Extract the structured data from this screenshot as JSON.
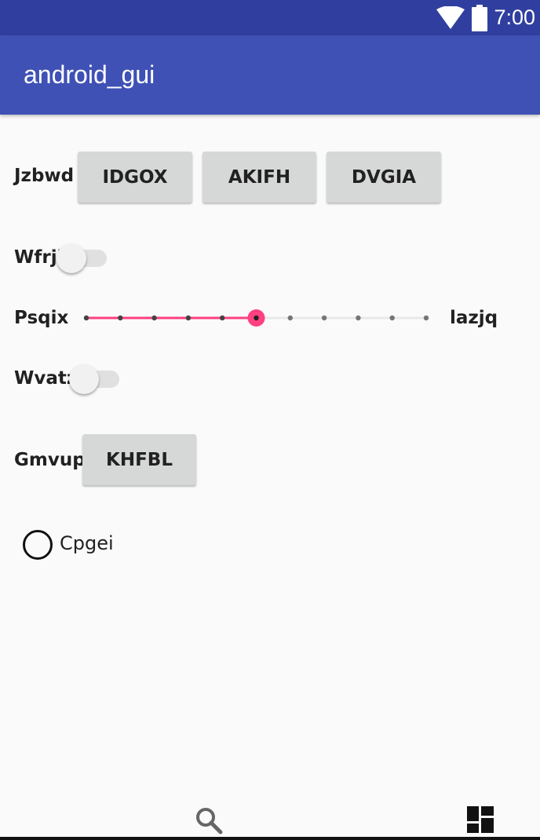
{
  "status_bar": {
    "time": "7:00",
    "wifi_icon": "wifi-icon",
    "battery_icon": "battery-icon"
  },
  "app_bar": {
    "title": "android_gui"
  },
  "rows": {
    "jzbwd": {
      "label": "Jzbwd",
      "buttons": [
        "IDGOX",
        "AKIFH",
        "DVGIA"
      ]
    },
    "wfrji": {
      "label": "Wfrji",
      "switch_on": false
    },
    "psqix": {
      "label": "Psqix",
      "end_label": "lazjq",
      "seek_max": 10,
      "seek_value": 5
    },
    "wvatz": {
      "label": "Wvatz",
      "switch_on": false
    },
    "gmvup": {
      "label": "Gmvup",
      "button": "KHFBL"
    },
    "radio": {
      "label": "Cpgei",
      "checked": false
    }
  },
  "bottom_bar": {
    "left_icon": "search-icon",
    "right_icon": "dashboard-icon"
  },
  "colors": {
    "status_bar": "#303f9f",
    "app_bar": "#3f51b5",
    "accent": "#ff4081"
  }
}
